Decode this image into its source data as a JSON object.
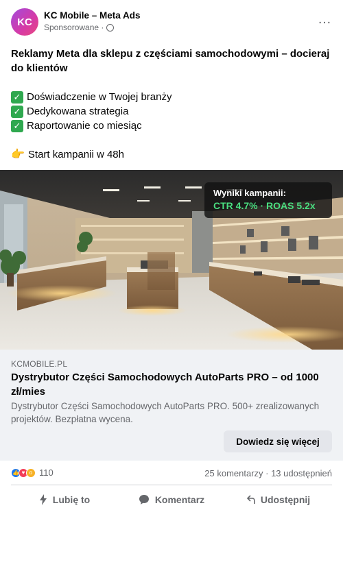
{
  "page": {
    "name": "KC Mobile – Meta Ads",
    "avatar_initials": "KC",
    "sponsored": "Sponsorowane ·",
    "more_icon": "…"
  },
  "post": {
    "headline": "Reklamy Meta dla sklepu z częściami samochodowymi – docieraj do klientów",
    "bullets": [
      "Doświadczenie w Twojej branży",
      "Dedykowana strategia",
      "Raportowanie co miesiąc"
    ],
    "cta_line": "Start kampanii w 48h"
  },
  "media": {
    "overlay_title": "Wyniki kampanii:",
    "overlay_metrics": "CTR 4.7% · ROAS 5.2x",
    "image_subject": "modern retail store interior with wooden counters and lit shelves"
  },
  "link_card": {
    "domain": "KCMOBILE.PL",
    "title": "Dystrybutor Części Samochodowych AutoParts PRO – od 1000 zł/mies",
    "description": "Dystrybutor Części Samochodowych AutoParts PRO. 500+ zrealizowanych projektów. Bezpłatna wycena.",
    "button": "Dowiedz się więcej"
  },
  "stats": {
    "reaction_count": "110",
    "comments_shares": "25 komentarzy · 13 udostępnień"
  },
  "actions": {
    "like": "Lubię to",
    "comment": "Komentarz",
    "share": "Udostępnij"
  },
  "colors": {
    "accent": "#1877f2",
    "metrics": "#4ade80",
    "avatar": "#c13fbf"
  }
}
